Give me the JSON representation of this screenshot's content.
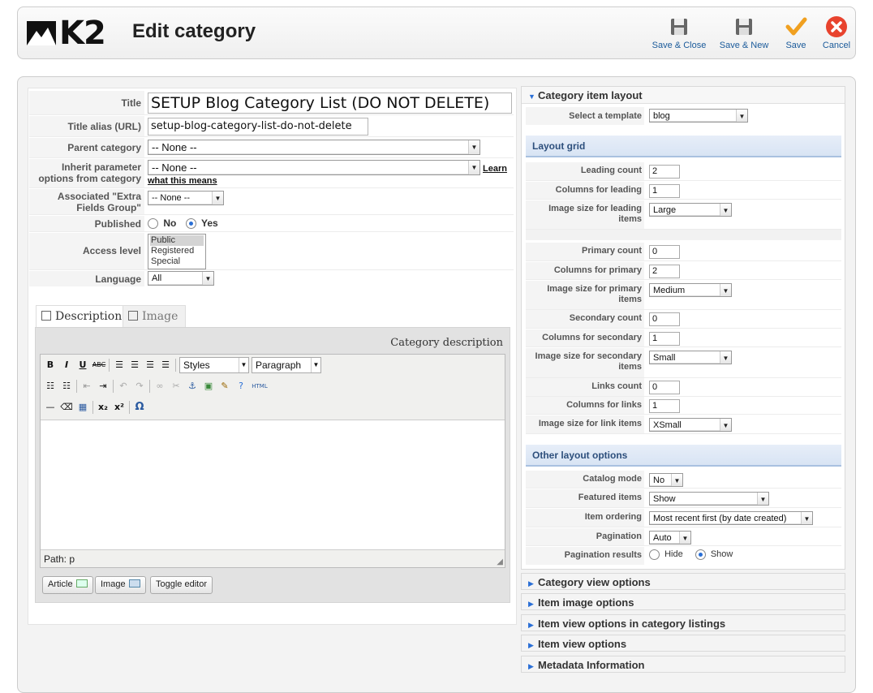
{
  "header": {
    "logo_text": "K2",
    "title": "Edit category",
    "buttons": [
      {
        "label": "Save & Close",
        "icon": "save-icon"
      },
      {
        "label": "Save & New",
        "icon": "save-icon"
      },
      {
        "label": "Save",
        "icon": "check-icon"
      },
      {
        "label": "Cancel",
        "icon": "cancel-icon"
      }
    ]
  },
  "form": {
    "title_label": "Title",
    "title_value": "SETUP Blog Category List (DO NOT DELETE)",
    "alias_label": "Title alias (URL)",
    "alias_value": "setup-blog-category-list-do-not-delete",
    "parent_label": "Parent category",
    "parent_value": "-- None --",
    "inherit_label": "Inherit parameter options from category",
    "inherit_value": "-- None --",
    "inherit_link": "Learn",
    "inherit_link2": "what this means",
    "extra_label": "Associated \"Extra Fields Group\"",
    "extra_value": "-- None --",
    "published_label": "Published",
    "published_no": "No",
    "published_yes": "Yes",
    "published_value": "Yes",
    "access_label": "Access level",
    "access_options": [
      "Public",
      "Registered",
      "Special"
    ],
    "access_selected": "Public",
    "language_label": "Language",
    "language_value": "All"
  },
  "tabs": [
    {
      "label": "Description",
      "active": true
    },
    {
      "label": "Image",
      "active": false
    }
  ],
  "editor": {
    "heading": "Category description",
    "styles_select": "Styles",
    "format_select": "Paragraph",
    "path": "Path: p",
    "buttons": [
      "Article",
      "Image",
      "Toggle editor"
    ]
  },
  "layout": {
    "header": "Category item layout",
    "template_label": "Select a template",
    "template_value": "blog",
    "grid_header": "Layout grid",
    "rows": [
      {
        "label": "Leading count",
        "value": "2",
        "type": "number"
      },
      {
        "label": "Columns for leading",
        "value": "1",
        "type": "number"
      },
      {
        "label": "Image size for leading items",
        "value": "Large",
        "type": "select"
      },
      {
        "label": "Primary count",
        "value": "0",
        "type": "number"
      },
      {
        "label": "Columns for primary",
        "value": "2",
        "type": "number"
      },
      {
        "label": "Image size for primary items",
        "value": "Medium",
        "type": "select"
      },
      {
        "label": "Secondary count",
        "value": "0",
        "type": "number"
      },
      {
        "label": "Columns for secondary",
        "value": "1",
        "type": "number"
      },
      {
        "label": "Image size for secondary items",
        "value": "Small",
        "type": "select"
      },
      {
        "label": "Links count",
        "value": "0",
        "type": "number"
      },
      {
        "label": "Columns for links",
        "value": "1",
        "type": "number"
      },
      {
        "label": "Image size for link items",
        "value": "XSmall",
        "type": "select"
      }
    ],
    "other_header": "Other layout options",
    "catalog_label": "Catalog mode",
    "catalog_value": "No",
    "featured_label": "Featured items",
    "featured_value": "Show",
    "ordering_label": "Item ordering",
    "ordering_value": "Most recent first (by date created)",
    "pagination_label": "Pagination",
    "pagination_value": "Auto",
    "pag_results_label": "Pagination results",
    "pag_hide": "Hide",
    "pag_show": "Show",
    "pag_results_value": "Show"
  },
  "accordions": [
    "Category view options",
    "Item image options",
    "Item view options in category listings",
    "Item view options",
    "Metadata Information"
  ],
  "colors": {
    "link_blue": "#1a5a9a",
    "section_blue": "#2d4f7c",
    "cancel_red": "#e8432e",
    "save_orange": "#f0a020"
  }
}
